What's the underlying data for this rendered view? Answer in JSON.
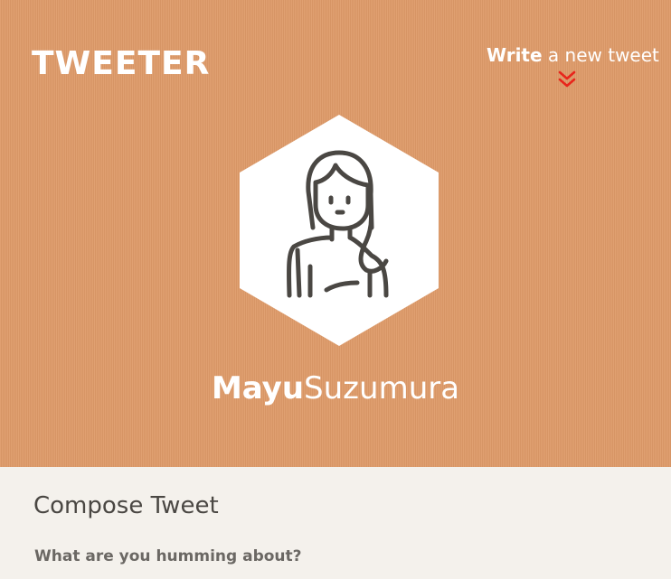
{
  "header": {
    "logo_text": "TWEETER",
    "write_strong": "Write",
    "write_rest": " a new tweet",
    "chevron_icon": "double-chevron-down-icon",
    "chevron_color": "#e8251b",
    "background_color": "#de9a68"
  },
  "profile": {
    "avatar_icon": "user-avatar-icon",
    "first_name": "Mayu",
    "last_name": "Suzumura"
  },
  "compose": {
    "title": "Compose Tweet",
    "prompt_label": "What are you humming about?"
  }
}
